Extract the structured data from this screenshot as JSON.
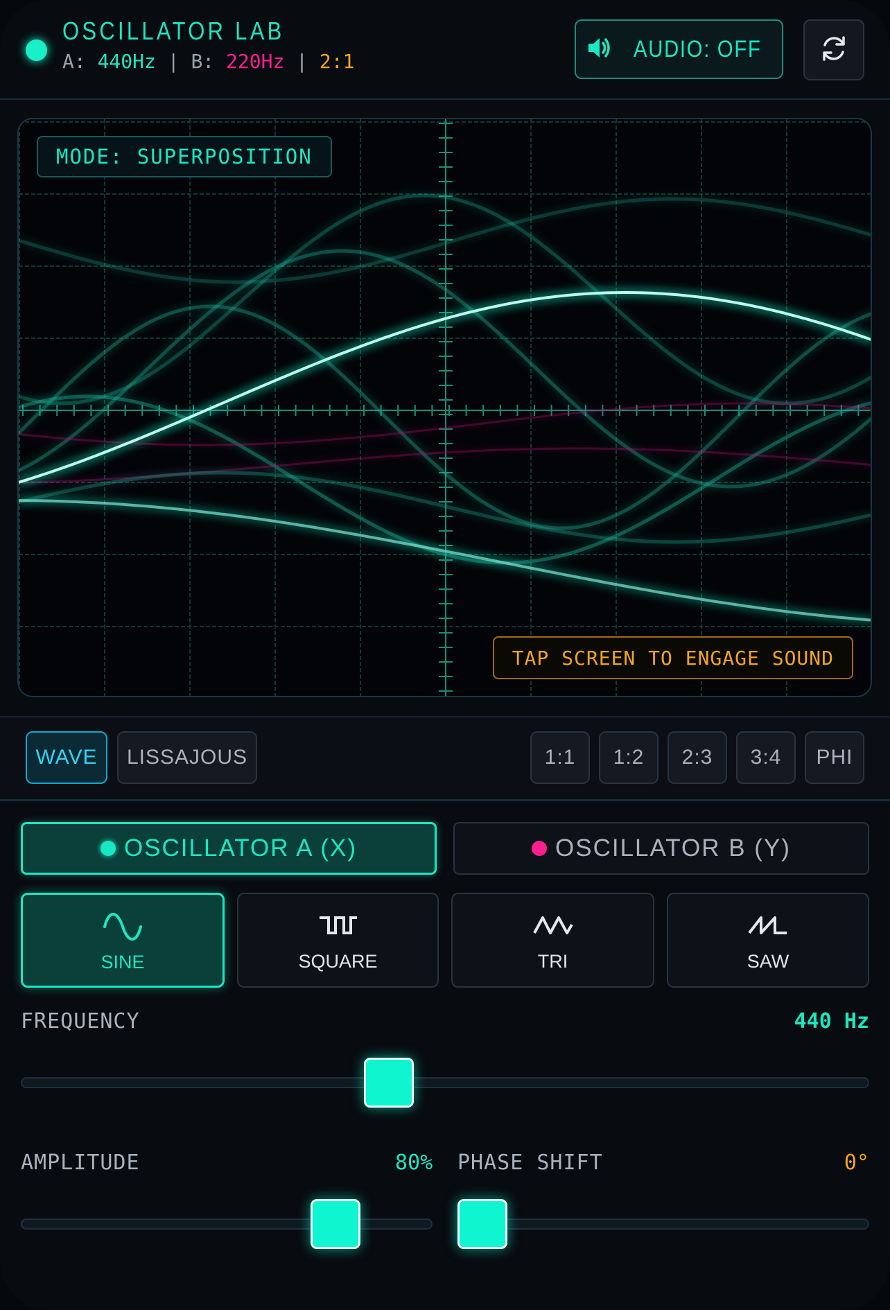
{
  "header": {
    "title": "OSCILLATOR LAB",
    "freq_a_prefix": "A: ",
    "freq_a": "440Hz",
    "sep1": " | B: ",
    "freq_b": "220Hz",
    "sep2": " | ",
    "ratio": "2:1",
    "audio_label": "AUDIO: OFF",
    "icons": {
      "audio": "speaker-icon",
      "reset": "refresh-icon"
    }
  },
  "scope": {
    "mode_label": "MODE: SUPERPOSITION",
    "tap_label": "TAP SCREEN TO ENGAGE SOUND"
  },
  "modebar": {
    "display_modes": [
      {
        "label": "WAVE",
        "active": true
      },
      {
        "label": "LISSAJOUS",
        "active": false
      }
    ],
    "ratios": [
      "1:1",
      "1:2",
      "2:3",
      "3:4",
      "PHI"
    ]
  },
  "oscillators": [
    {
      "label": "OSCILLATOR A (X)",
      "active": true,
      "color": "#19e8c2"
    },
    {
      "label": "OSCILLATOR B (Y)",
      "active": false,
      "color": "#ff1f8e"
    }
  ],
  "waveforms": [
    {
      "label": "SINE",
      "icon": "sine-wave-icon",
      "active": true
    },
    {
      "label": "SQUARE",
      "icon": "square-wave-icon",
      "active": false
    },
    {
      "label": "TRI",
      "icon": "triangle-wave-icon",
      "active": false
    },
    {
      "label": "SAW",
      "icon": "sawtooth-wave-icon",
      "active": false
    }
  ],
  "controls": {
    "frequency": {
      "label": "FREQUENCY",
      "value_text": "440 Hz",
      "level": 0.43
    },
    "amplitude": {
      "label": "AMPLITUDE",
      "value_text": "80%",
      "level": 0.8
    },
    "phase": {
      "label": "PHASE SHIFT",
      "value_text": "0°",
      "level": 0.0
    }
  },
  "colors": {
    "accent": "#19e8c2",
    "osc_b": "#ff1f8e",
    "ratio": "#f3a51c",
    "mode_active": "#32d4f4"
  }
}
